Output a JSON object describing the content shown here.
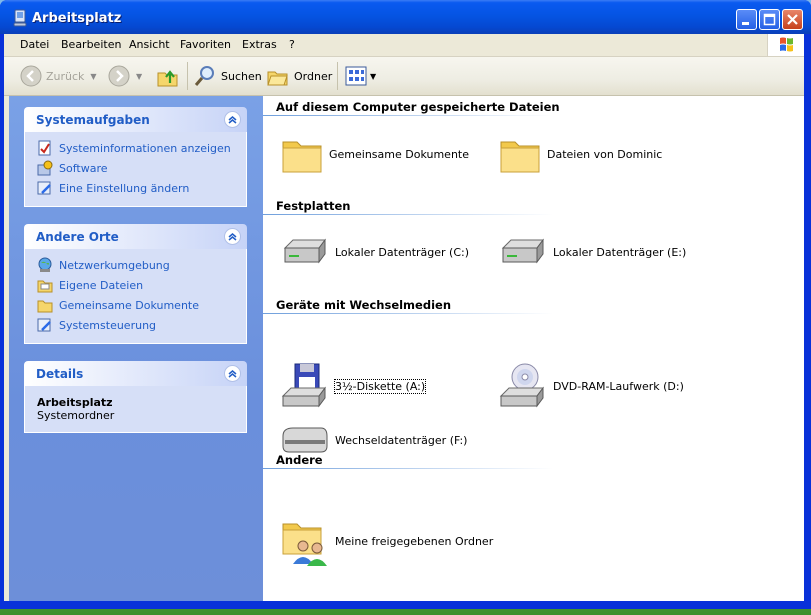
{
  "window": {
    "title": "Arbeitsplatz"
  },
  "menu": [
    "Datei",
    "Bearbeiten",
    "Ansicht",
    "Favoriten",
    "Extras",
    "?"
  ],
  "toolbar": {
    "back_label": "Zurück",
    "search_label": "Suchen",
    "folders_label": "Ordner"
  },
  "sidebar": {
    "system_tasks": {
      "title": "Systemaufgaben",
      "items": [
        "Systeminformationen anzeigen",
        "Software",
        "Eine Einstellung ändern"
      ]
    },
    "other_places": {
      "title": "Andere Orte",
      "items": [
        "Netzwerkumgebung",
        "Eigene Dateien",
        "Gemeinsame Dokumente",
        "Systemsteuerung"
      ]
    },
    "details": {
      "title": "Details",
      "name": "Arbeitsplatz",
      "type": "Systemordner"
    }
  },
  "content": {
    "stored_files": {
      "title": "Auf diesem Computer gespeicherte Dateien",
      "items": [
        "Gemeinsame Dokumente",
        "Dateien von Dominic"
      ]
    },
    "hard_drives": {
      "title": "Festplatten",
      "items": [
        "Lokaler Datenträger (C:)",
        "Lokaler Datenträger (E:)"
      ]
    },
    "removable": {
      "title": "Geräte mit Wechselmedien",
      "items": [
        "3½-Diskette (A:)",
        "DVD-RAM-Laufwerk (D:)",
        "Wechseldatenträger (F:)"
      ]
    },
    "other": {
      "title": "Andere",
      "items": [
        "Meine freigegebenen Ordner"
      ]
    }
  },
  "colors": {
    "title_bar": "#0554e3",
    "sidebar_bg": "#6d8fd9",
    "link": "#215dc6"
  }
}
